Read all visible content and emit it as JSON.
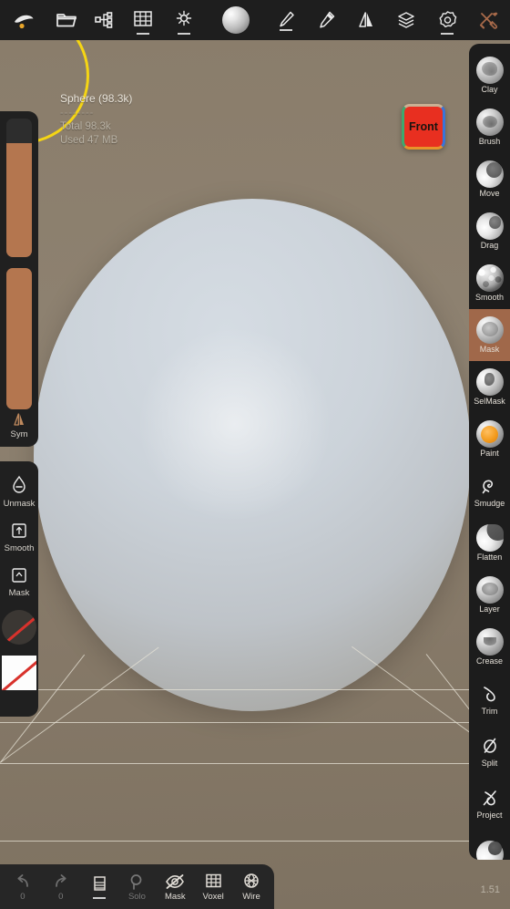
{
  "app": {
    "version": "1.51"
  },
  "topbar": {
    "items": [
      {
        "name": "sculpt-object-icon",
        "label": ""
      },
      {
        "name": "open-folder-icon",
        "label": ""
      },
      {
        "name": "scene-graph-icon",
        "label": ""
      },
      {
        "name": "grid-icon",
        "label": ""
      },
      {
        "name": "light-icon",
        "label": ""
      },
      {
        "name": "material-sphere-icon",
        "label": ""
      },
      {
        "name": "brush-icon",
        "label": ""
      },
      {
        "name": "paint-bucket-icon",
        "label": ""
      },
      {
        "name": "mirror-icon",
        "label": ""
      },
      {
        "name": "layers-icon",
        "label": ""
      },
      {
        "name": "settings-gear-icon",
        "label": ""
      },
      {
        "name": "tools-icon",
        "label": ""
      }
    ]
  },
  "viewport": {
    "info": {
      "title": "Sphere (98.3k)",
      "divider": "--------",
      "total": "Total 98.3k",
      "used": "Used 47 MB"
    },
    "view_cube_label": "Front"
  },
  "left_panel": {
    "sliders": [
      {
        "name": "brush-size-slider",
        "fill_percent": 82
      },
      {
        "name": "brush-intensity-slider",
        "fill_percent": 100
      }
    ],
    "symmetry": {
      "label": "Sym"
    }
  },
  "left_panel_tools": [
    {
      "label": "Unmask",
      "icon": "droplet-minus-icon"
    },
    {
      "label": "Smooth",
      "icon": "square-up-arrow-icon"
    },
    {
      "label": "Mask",
      "icon": "square-caret-up-icon"
    }
  ],
  "left_panel_swatches": [
    {
      "name": "alpha-swatch-none",
      "kind": "circle"
    },
    {
      "name": "stencil-swatch-none",
      "kind": "square"
    }
  ],
  "right_panel": {
    "tools": [
      {
        "label": "Clay",
        "icon": "clay-ball-icon",
        "active": false
      },
      {
        "label": "Brush",
        "icon": "brush-ball-icon",
        "active": false
      },
      {
        "label": "Move",
        "icon": "move-ball-icon",
        "active": false
      },
      {
        "label": "Drag",
        "icon": "drag-ball-icon",
        "active": false
      },
      {
        "label": "Smooth",
        "icon": "smooth-ball-icon",
        "active": false
      },
      {
        "label": "Mask",
        "icon": "mask-ball-icon",
        "active": true
      },
      {
        "label": "SelMask",
        "icon": "selmask-ball-icon",
        "active": false
      },
      {
        "label": "Paint",
        "icon": "paint-ball-icon",
        "active": false
      },
      {
        "label": "Smudge",
        "icon": "smudge-icon",
        "active": false
      },
      {
        "label": "Flatten",
        "icon": "flatten-ball-icon",
        "active": false
      },
      {
        "label": "Layer",
        "icon": "layer-ball-icon",
        "active": false
      },
      {
        "label": "Crease",
        "icon": "crease-ball-icon",
        "active": false
      },
      {
        "label": "Trim",
        "icon": "trim-lasso-icon",
        "active": false
      },
      {
        "label": "Split",
        "icon": "split-slash-icon",
        "active": false
      },
      {
        "label": "Project",
        "icon": "project-lasso-icon",
        "active": false
      },
      {
        "label": "",
        "icon": "inflate-ball-icon",
        "active": false
      }
    ]
  },
  "bottom_bar": {
    "items": [
      {
        "label": "0",
        "icon": "undo-icon",
        "dim": true
      },
      {
        "label": "0",
        "icon": "redo-icon",
        "dim": true
      },
      {
        "label": "",
        "icon": "layers-list-icon",
        "dim": false
      },
      {
        "label": "Solo",
        "icon": "solo-magnifier-icon",
        "dim": true
      },
      {
        "label": "Mask",
        "icon": "eye-slash-icon",
        "dim": false
      },
      {
        "label": "Voxel",
        "icon": "voxel-grid-icon",
        "dim": false
      },
      {
        "label": "Wire",
        "icon": "wireframe-sphere-icon",
        "dim": false
      }
    ]
  },
  "colors": {
    "accent_active": "#a0684a",
    "slider_fill": "#b4764f",
    "front_button": "#e82f20",
    "brush_cursor": "#f5d514",
    "viewport_bg": "#8a7d6b"
  }
}
